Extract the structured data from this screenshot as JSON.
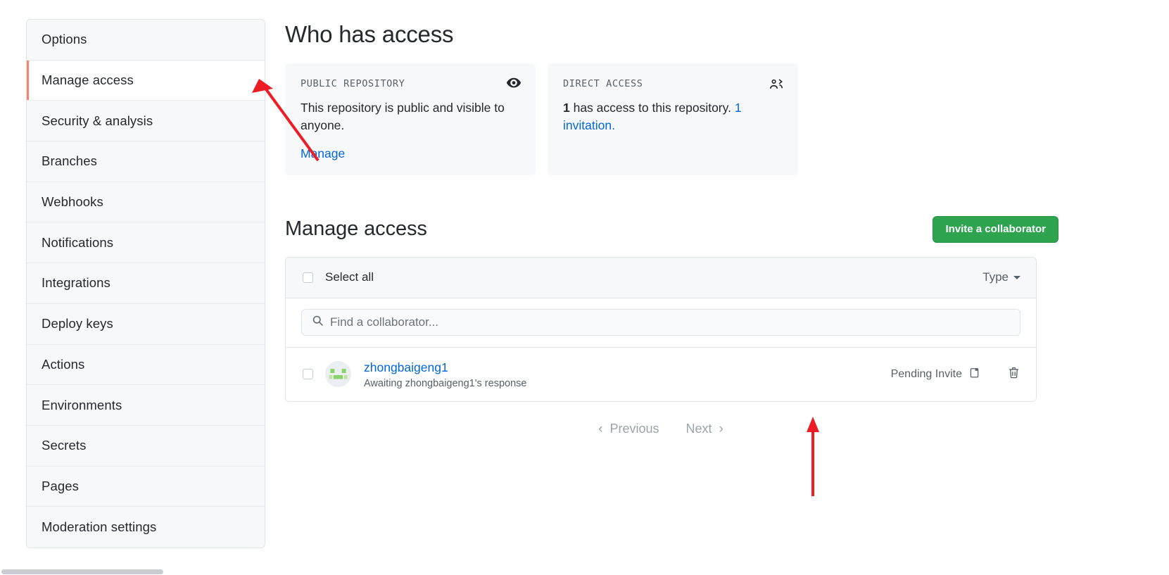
{
  "sidebar": {
    "items": [
      {
        "label": "Options",
        "active": false
      },
      {
        "label": "Manage access",
        "active": true
      },
      {
        "label": "Security & analysis",
        "active": false
      },
      {
        "label": "Branches",
        "active": false
      },
      {
        "label": "Webhooks",
        "active": false
      },
      {
        "label": "Notifications",
        "active": false
      },
      {
        "label": "Integrations",
        "active": false
      },
      {
        "label": "Deploy keys",
        "active": false
      },
      {
        "label": "Actions",
        "active": false
      },
      {
        "label": "Environments",
        "active": false
      },
      {
        "label": "Secrets",
        "active": false
      },
      {
        "label": "Pages",
        "active": false
      },
      {
        "label": "Moderation settings",
        "active": false
      }
    ]
  },
  "who_has_access": {
    "title": "Who has access",
    "public_card": {
      "label": "PUBLIC REPOSITORY",
      "icon": "eye-icon",
      "description": "This repository is public and visible to anyone.",
      "link": "Manage"
    },
    "direct_card": {
      "label": "DIRECT ACCESS",
      "icon": "people-icon",
      "count": "1",
      "description": " has access to this repository. ",
      "link": "1 invitation."
    }
  },
  "manage_access": {
    "title": "Manage access",
    "invite_button": "Invite a collaborator",
    "select_all_label": "Select all",
    "type_filter": "Type",
    "search_placeholder": "Find a collaborator...",
    "search_value": "",
    "collaborators": [
      {
        "username": "zhongbaigeng1",
        "subtitle": "Awaiting zhongbaigeng1's response",
        "status": "Pending Invite",
        "status_icon": "clipboard-icon",
        "delete_icon": "trash-icon"
      }
    ],
    "pagination": {
      "previous": "Previous",
      "next": "Next"
    }
  },
  "colors": {
    "accent_green": "#2ea44f",
    "link_blue": "#0366d6",
    "active_border": "#f9826c",
    "annotation_red": "#ee1c25"
  }
}
